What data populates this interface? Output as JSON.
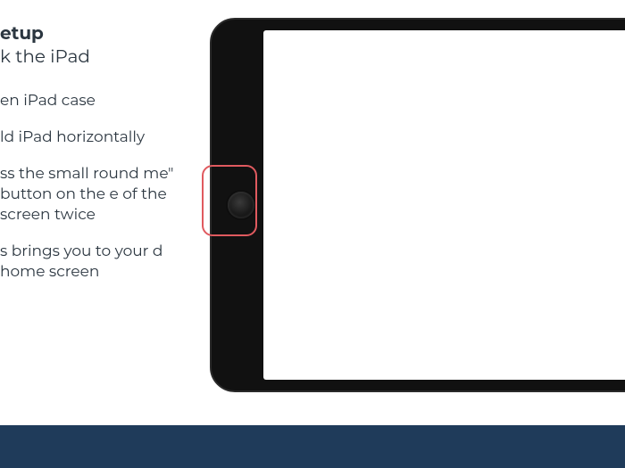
{
  "heading": "etup",
  "subheading": "k the iPad",
  "bullets": [
    "en iPad case",
    "ld iPad horizontally",
    "ss the small round me\" button on the e of the screen twice",
    "s brings you to your d home screen"
  ],
  "ipad": {
    "home_button_name": "home-button"
  },
  "highlight": {
    "target": "home-button"
  },
  "colors": {
    "footer_bg": "#1f3b5a",
    "highlight_border": "#e05a5f",
    "text": "#2b3640"
  }
}
